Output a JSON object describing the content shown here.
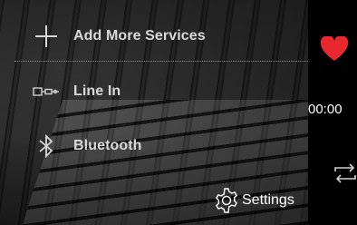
{
  "menu": {
    "items": [
      {
        "label": "Add More Services",
        "icon": "plus-icon"
      },
      {
        "label": "Line In",
        "icon": "line-in-plug-icon"
      },
      {
        "label": "Bluetooth",
        "icon": "bluetooth-icon"
      }
    ],
    "settings_label": "Settings",
    "settings_icon": "gear-icon"
  },
  "player": {
    "elapsed_time": "00:00",
    "favorite_icon": "heart-icon",
    "repeat_icon": "repeat-icon"
  },
  "colors": {
    "heart": "#e8272f",
    "menu_text": "#d9d9d9",
    "settings_text": "#ffffff",
    "strip_bg": "#000000"
  }
}
